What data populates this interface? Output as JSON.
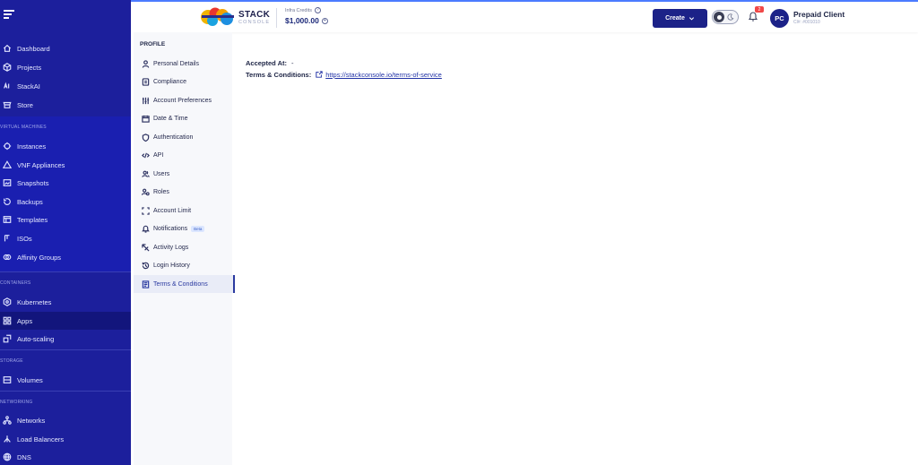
{
  "header": {
    "logo_text": "STACK",
    "logo_subtext": "CONSOLE",
    "credits_label": "Infra Credits",
    "credits_amount": "$1,000.00",
    "create_label": "Create",
    "notification_count": "2",
    "avatar_initials": "PC",
    "user_name": "Prepaid Client",
    "client_id": "Cl#: #001010"
  },
  "sidebar": {
    "top_items": [
      {
        "label": "Dashboard",
        "icon": "home-icon"
      },
      {
        "label": "Projects",
        "icon": "cube-icon"
      },
      {
        "label": "StackAI",
        "icon": "ai-icon"
      },
      {
        "label": "Store",
        "icon": "store-icon"
      }
    ],
    "sections": [
      {
        "title": "VIRTUAL MACHINES",
        "items": [
          {
            "label": "Instances",
            "icon": "instances-icon"
          },
          {
            "label": "VNF Appliances",
            "icon": "vnf-icon"
          },
          {
            "label": "Snapshots",
            "icon": "snapshot-icon"
          },
          {
            "label": "Backups",
            "icon": "backup-icon"
          },
          {
            "label": "Templates",
            "icon": "template-icon"
          },
          {
            "label": "ISOs",
            "icon": "iso-icon"
          },
          {
            "label": "Affinity Groups",
            "icon": "affinity-icon"
          }
        ]
      },
      {
        "title": "CONTAINERS",
        "items": [
          {
            "label": "Kubernetes",
            "icon": "kubernetes-icon"
          },
          {
            "label": "Apps",
            "icon": "apps-icon"
          },
          {
            "label": "Auto-scaling",
            "icon": "autoscaling-icon"
          }
        ]
      },
      {
        "title": "STORAGE",
        "items": [
          {
            "label": "Volumes",
            "icon": "volume-icon"
          }
        ]
      },
      {
        "title": "NETWORKING",
        "items": [
          {
            "label": "Networks",
            "icon": "network-icon"
          },
          {
            "label": "Load Balancers",
            "icon": "load-balancer-icon"
          },
          {
            "label": "DNS",
            "icon": "dns-icon"
          }
        ]
      }
    ]
  },
  "profile_menu": {
    "title": "PROFILE",
    "items": [
      {
        "label": "Personal Details",
        "icon": "user-icon"
      },
      {
        "label": "Compliance",
        "icon": "document-icon"
      },
      {
        "label": "Account Preferences",
        "icon": "sliders-icon"
      },
      {
        "label": "Date & Time",
        "icon": "calendar-icon"
      },
      {
        "label": "Authentication",
        "icon": "shield-icon"
      },
      {
        "label": "API",
        "icon": "code-icon"
      },
      {
        "label": "Users",
        "icon": "users-icon"
      },
      {
        "label": "Roles",
        "icon": "roles-icon"
      },
      {
        "label": "Account Limit",
        "icon": "limit-icon"
      },
      {
        "label": "Notifications",
        "icon": "bell-icon",
        "badge": "Beta"
      },
      {
        "label": "Activity Logs",
        "icon": "activity-icon"
      },
      {
        "label": "Login History",
        "icon": "history-icon"
      },
      {
        "label": "Terms & Conditions",
        "icon": "terms-icon"
      }
    ],
    "active": "Terms & Conditions"
  },
  "main": {
    "accepted_label": "Accepted At:",
    "accepted_value": "-",
    "terms_label": "Terms & Conditions:",
    "terms_link": "https://stackconsole.io/terms-of-service"
  },
  "colors": {
    "sidebar_bg": "#1c1f9c",
    "primary": "#1c2288",
    "link": "#2233a6",
    "badge": "#f04848"
  }
}
